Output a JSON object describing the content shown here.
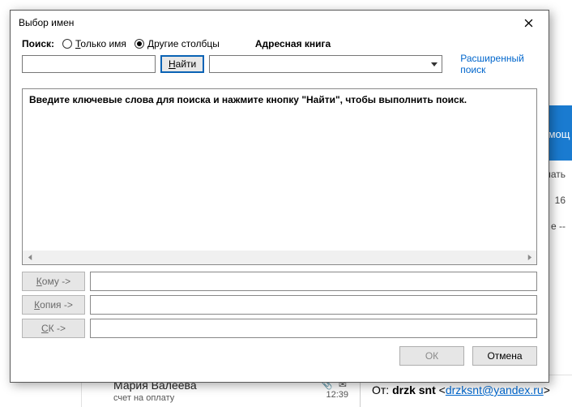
{
  "dialog": {
    "title": "Выбор имен",
    "search_label": "Поиск:",
    "radio_name_only": {
      "underline": "Т",
      "rest": "олько имя"
    },
    "radio_other_cols": {
      "underline": "Д",
      "rest": "ругие столбцы"
    },
    "address_book_label": "Адресная книга",
    "search_value": "",
    "find_button": {
      "underline": "Н",
      "rest": "айти"
    },
    "address_book_value": "",
    "advanced_link": "Расширенный поиск",
    "results_hint": "Введите ключевые слова для поиска и нажмите кнопку \"Найти\", чтобы выполнить поиск.",
    "recipients": {
      "to": {
        "underline": "К",
        "rest": "ому ->",
        "value": ""
      },
      "cc": {
        "underline": "К",
        "rest": "опия ->",
        "value": ""
      },
      "bcc": {
        "underline": "С",
        "rest": "К ->",
        "value": ""
      }
    },
    "ok_label": "ОК",
    "cancel_label": "Отмена"
  },
  "background": {
    "help_tab": "Помощ",
    "panel_item_1": "лать",
    "panel_item_2": "16",
    "email": {
      "sender": "Мария Валеева",
      "subject": "счет на оплату",
      "time": "12:39",
      "from_label": "От:",
      "from_name": "drzk snt",
      "from_email": "drzksnt@yandex.ru",
      "trail": "е --"
    }
  }
}
